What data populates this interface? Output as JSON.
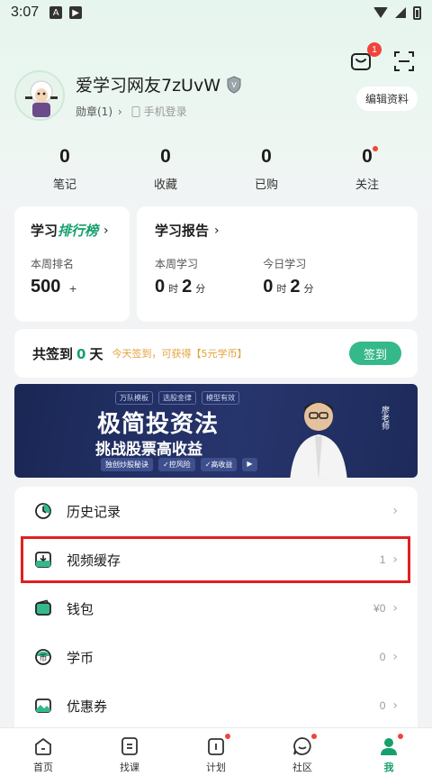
{
  "status_bar": {
    "time": "3:07"
  },
  "header": {
    "message_badge": "1"
  },
  "profile": {
    "username": "爱学习网友7zUvW",
    "medals": "勋章(1)",
    "login_method": "手机登录",
    "edit_button": "编辑资料"
  },
  "stats": [
    {
      "value": "0",
      "label": "笔记"
    },
    {
      "value": "0",
      "label": "收藏"
    },
    {
      "value": "0",
      "label": "已购"
    },
    {
      "value": "0",
      "label": "关注"
    }
  ],
  "rank_card": {
    "title_prefix": "学习",
    "title_accent": "排行榜",
    "sub_label": "本周排名",
    "value": "500",
    "suffix": "+"
  },
  "report_card": {
    "title": "学习报告",
    "week_label": "本周学习",
    "week_hours": "0",
    "week_minutes": "2",
    "today_label": "今日学习",
    "today_hours": "0",
    "today_minutes": "2",
    "hour_unit": "时",
    "minute_unit": "分"
  },
  "signin": {
    "prefix": "共签到",
    "days": "0",
    "suffix": "天",
    "hint": "今天签到，可获得【5元学币】",
    "button": "签到"
  },
  "banner": {
    "tags": [
      "万队模板",
      "选股金律",
      "模型有效"
    ],
    "title": "极简投资法",
    "subtitle": "挑战股票高收益",
    "pills": [
      "独创炒股秘诀",
      "✓控风险",
      "✓高收益"
    ],
    "person_name": "廖老师"
  },
  "menu": [
    {
      "label": "历史记录",
      "value": "",
      "icon": "history-icon"
    },
    {
      "label": "视频缓存",
      "value": "1",
      "icon": "download-icon"
    },
    {
      "label": "钱包",
      "value": "¥0",
      "icon": "wallet-icon"
    },
    {
      "label": "学币",
      "value": "0",
      "icon": "coin-icon"
    },
    {
      "label": "优惠券",
      "value": "0",
      "icon": "coupon-icon"
    }
  ],
  "bottom_nav": [
    {
      "label": "首页",
      "icon": "home-icon"
    },
    {
      "label": "找课",
      "icon": "course-icon"
    },
    {
      "label": "计划",
      "icon": "plan-icon"
    },
    {
      "label": "社区",
      "icon": "community-icon"
    },
    {
      "label": "我",
      "icon": "profile-icon"
    }
  ],
  "colors": {
    "accent": "#17a06b",
    "button": "#35b98a",
    "badge": "#f0453b",
    "highlight": "#e02020"
  }
}
